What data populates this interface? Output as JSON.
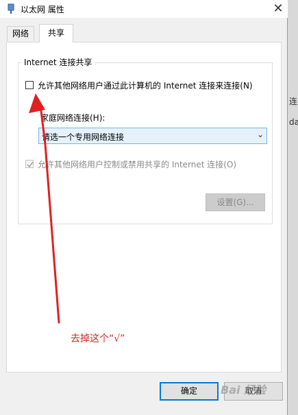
{
  "window": {
    "title": "以太网 属性",
    "close_glyph": "✕"
  },
  "tabs": [
    {
      "label": "网络"
    },
    {
      "label": "共享"
    }
  ],
  "sharing": {
    "group_title": "Internet 连接共享",
    "allow_others_label": "允许其他网络用户通过此计算机的 Internet 连接来连接(N)",
    "allow_others_checked": false,
    "home_network_label": "家庭网络连接(H):",
    "home_network_value": "请选一个专用网络连接",
    "allow_control_label": "允许其他网络用户控制或禁用共享的 Internet 连接(O)",
    "allow_control_checked": true,
    "settings_button": "设置(G)..."
  },
  "annotation": {
    "text": "去掉这个“√”",
    "color": "#e02020"
  },
  "footer": {
    "ok_button": "确定",
    "cancel_button": "取消"
  },
  "watermark": "Bai 经验",
  "background_window": {
    "text_a": "连",
    "text_b": "dap"
  }
}
